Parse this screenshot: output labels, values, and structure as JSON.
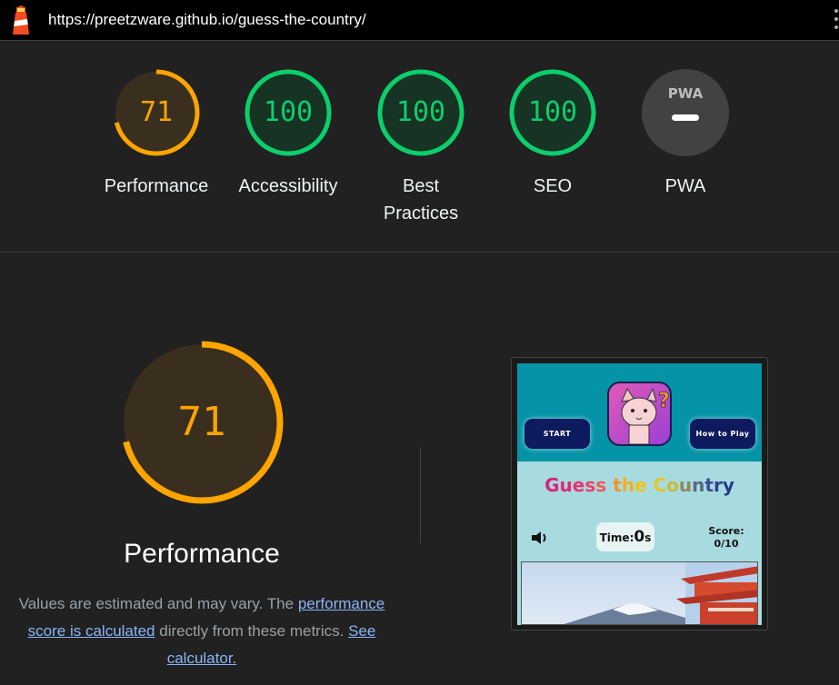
{
  "url": "https://preetzware.github.io/guess-the-country/",
  "gauges": [
    {
      "label": "Performance",
      "score": "71",
      "score_fraction": 0.71,
      "color": "#ffa400"
    },
    {
      "label": "Accessibility",
      "score": "100",
      "score_fraction": 1.0,
      "color": "#0cce6b"
    },
    {
      "label": "Best Practices",
      "score": "100",
      "score_fraction": 1.0,
      "color": "#0cce6b"
    },
    {
      "label": "SEO",
      "score": "100",
      "score_fraction": 1.0,
      "color": "#0cce6b"
    },
    {
      "label": "PWA",
      "badge": "PWA",
      "icon": "pwa-dash-icon"
    }
  ],
  "performance": {
    "score": "71",
    "title": "Performance",
    "desc_prefix": "Values are estimated and may vary. The ",
    "link_calc": "performance score is calculated",
    "desc_middle": " directly from these metrics. ",
    "link_calculator": "See calculator."
  },
  "preview": {
    "start_label": "START",
    "howto_label": "How to Play",
    "title_letters": [
      "G",
      "u",
      "e",
      "s",
      "s",
      " ",
      "t",
      "h",
      "e",
      " ",
      "C",
      "o",
      "u",
      "n",
      "t",
      "r",
      "y"
    ],
    "timer_label": "Time:",
    "timer_value": "0",
    "timer_unit": "s",
    "score_label": "Score:",
    "score_value": "0/10"
  },
  "colors": {
    "orange": "#ffa400",
    "green": "#0cce6b",
    "bg": "#212121"
  }
}
